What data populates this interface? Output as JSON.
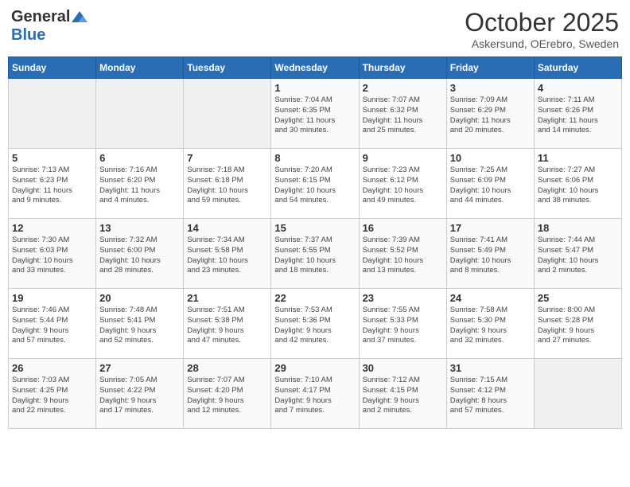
{
  "header": {
    "logo_general": "General",
    "logo_blue": "Blue",
    "month": "October 2025",
    "location": "Askersund, OErebro, Sweden"
  },
  "days_of_week": [
    "Sunday",
    "Monday",
    "Tuesday",
    "Wednesday",
    "Thursday",
    "Friday",
    "Saturday"
  ],
  "weeks": [
    [
      {
        "day": "",
        "info": ""
      },
      {
        "day": "",
        "info": ""
      },
      {
        "day": "",
        "info": ""
      },
      {
        "day": "1",
        "info": "Sunrise: 7:04 AM\nSunset: 6:35 PM\nDaylight: 11 hours\nand 30 minutes."
      },
      {
        "day": "2",
        "info": "Sunrise: 7:07 AM\nSunset: 6:32 PM\nDaylight: 11 hours\nand 25 minutes."
      },
      {
        "day": "3",
        "info": "Sunrise: 7:09 AM\nSunset: 6:29 PM\nDaylight: 11 hours\nand 20 minutes."
      },
      {
        "day": "4",
        "info": "Sunrise: 7:11 AM\nSunset: 6:26 PM\nDaylight: 11 hours\nand 14 minutes."
      }
    ],
    [
      {
        "day": "5",
        "info": "Sunrise: 7:13 AM\nSunset: 6:23 PM\nDaylight: 11 hours\nand 9 minutes."
      },
      {
        "day": "6",
        "info": "Sunrise: 7:16 AM\nSunset: 6:20 PM\nDaylight: 11 hours\nand 4 minutes."
      },
      {
        "day": "7",
        "info": "Sunrise: 7:18 AM\nSunset: 6:18 PM\nDaylight: 10 hours\nand 59 minutes."
      },
      {
        "day": "8",
        "info": "Sunrise: 7:20 AM\nSunset: 6:15 PM\nDaylight: 10 hours\nand 54 minutes."
      },
      {
        "day": "9",
        "info": "Sunrise: 7:23 AM\nSunset: 6:12 PM\nDaylight: 10 hours\nand 49 minutes."
      },
      {
        "day": "10",
        "info": "Sunrise: 7:25 AM\nSunset: 6:09 PM\nDaylight: 10 hours\nand 44 minutes."
      },
      {
        "day": "11",
        "info": "Sunrise: 7:27 AM\nSunset: 6:06 PM\nDaylight: 10 hours\nand 38 minutes."
      }
    ],
    [
      {
        "day": "12",
        "info": "Sunrise: 7:30 AM\nSunset: 6:03 PM\nDaylight: 10 hours\nand 33 minutes."
      },
      {
        "day": "13",
        "info": "Sunrise: 7:32 AM\nSunset: 6:00 PM\nDaylight: 10 hours\nand 28 minutes."
      },
      {
        "day": "14",
        "info": "Sunrise: 7:34 AM\nSunset: 5:58 PM\nDaylight: 10 hours\nand 23 minutes."
      },
      {
        "day": "15",
        "info": "Sunrise: 7:37 AM\nSunset: 5:55 PM\nDaylight: 10 hours\nand 18 minutes."
      },
      {
        "day": "16",
        "info": "Sunrise: 7:39 AM\nSunset: 5:52 PM\nDaylight: 10 hours\nand 13 minutes."
      },
      {
        "day": "17",
        "info": "Sunrise: 7:41 AM\nSunset: 5:49 PM\nDaylight: 10 hours\nand 8 minutes."
      },
      {
        "day": "18",
        "info": "Sunrise: 7:44 AM\nSunset: 5:47 PM\nDaylight: 10 hours\nand 2 minutes."
      }
    ],
    [
      {
        "day": "19",
        "info": "Sunrise: 7:46 AM\nSunset: 5:44 PM\nDaylight: 9 hours\nand 57 minutes."
      },
      {
        "day": "20",
        "info": "Sunrise: 7:48 AM\nSunset: 5:41 PM\nDaylight: 9 hours\nand 52 minutes."
      },
      {
        "day": "21",
        "info": "Sunrise: 7:51 AM\nSunset: 5:38 PM\nDaylight: 9 hours\nand 47 minutes."
      },
      {
        "day": "22",
        "info": "Sunrise: 7:53 AM\nSunset: 5:36 PM\nDaylight: 9 hours\nand 42 minutes."
      },
      {
        "day": "23",
        "info": "Sunrise: 7:55 AM\nSunset: 5:33 PM\nDaylight: 9 hours\nand 37 minutes."
      },
      {
        "day": "24",
        "info": "Sunrise: 7:58 AM\nSunset: 5:30 PM\nDaylight: 9 hours\nand 32 minutes."
      },
      {
        "day": "25",
        "info": "Sunrise: 8:00 AM\nSunset: 5:28 PM\nDaylight: 9 hours\nand 27 minutes."
      }
    ],
    [
      {
        "day": "26",
        "info": "Sunrise: 7:03 AM\nSunset: 4:25 PM\nDaylight: 9 hours\nand 22 minutes."
      },
      {
        "day": "27",
        "info": "Sunrise: 7:05 AM\nSunset: 4:22 PM\nDaylight: 9 hours\nand 17 minutes."
      },
      {
        "day": "28",
        "info": "Sunrise: 7:07 AM\nSunset: 4:20 PM\nDaylight: 9 hours\nand 12 minutes."
      },
      {
        "day": "29",
        "info": "Sunrise: 7:10 AM\nSunset: 4:17 PM\nDaylight: 9 hours\nand 7 minutes."
      },
      {
        "day": "30",
        "info": "Sunrise: 7:12 AM\nSunset: 4:15 PM\nDaylight: 9 hours\nand 2 minutes."
      },
      {
        "day": "31",
        "info": "Sunrise: 7:15 AM\nSunset: 4:12 PM\nDaylight: 8 hours\nand 57 minutes."
      },
      {
        "day": "",
        "info": ""
      }
    ]
  ]
}
